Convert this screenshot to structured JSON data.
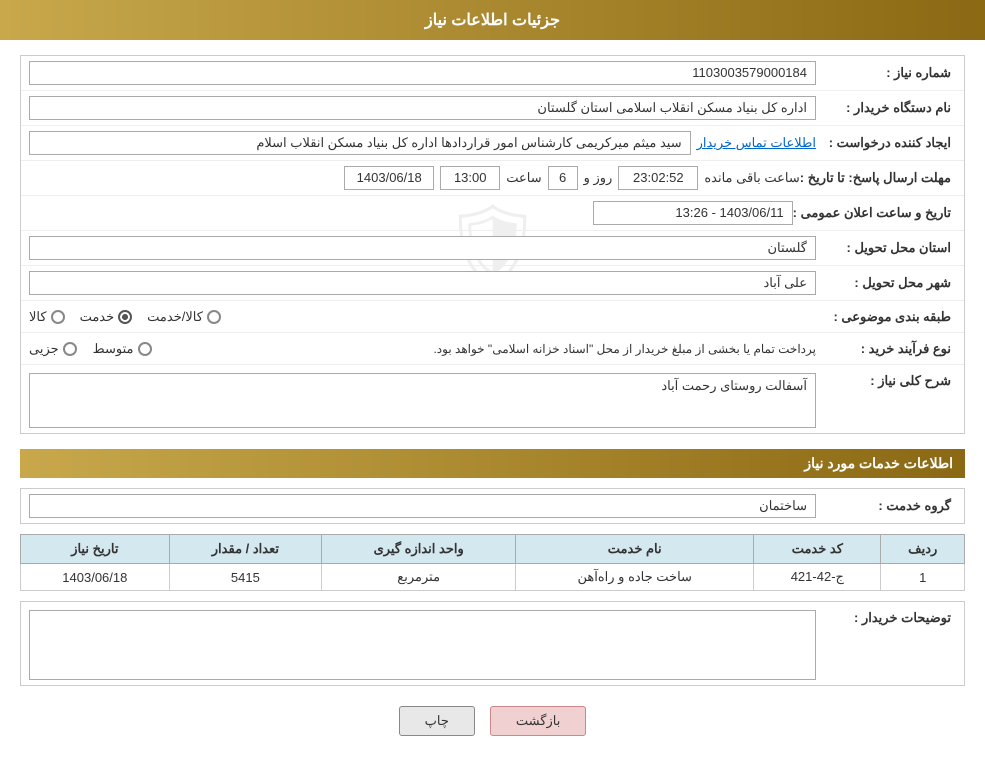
{
  "header": {
    "title": "جزئیات اطلاعات نیاز"
  },
  "fields": {
    "need_number_label": "شماره نیاز :",
    "need_number_value": "1103003579000184",
    "buyer_org_label": "نام دستگاه خریدار :",
    "buyer_org_value": "اداره کل بنیاد مسکن انقلاب اسلامی استان گلستان",
    "creator_label": "ایجاد کننده درخواست :",
    "creator_value": "سید میثم میرکریمی کارشناس امور قراردادها اداره کل بنیاد مسکن انقلاب اسلام",
    "creator_link": "اطلاعات تماس خریدار",
    "deadline_label": "مهلت ارسال پاسخ: تا تاریخ :",
    "deadline_date": "1403/06/18",
    "deadline_time": "13:00",
    "deadline_days": "6",
    "deadline_remaining": "23:02:52",
    "deadline_remaining_suffix": "ساعت باقی مانده",
    "deadline_days_suffix": "روز و",
    "announce_label": "تاریخ و ساعت اعلان عمومی :",
    "announce_value": "1403/06/11 - 13:26",
    "province_label": "استان محل تحویل :",
    "province_value": "گلستان",
    "city_label": "شهر محل تحویل :",
    "city_value": "علی آباد",
    "category_label": "طبقه بندی موضوعی :",
    "category_options": [
      "کالا",
      "خدمت",
      "کالا/خدمت"
    ],
    "category_selected": "خدمت",
    "purchase_type_label": "نوع فرآیند خرید :",
    "purchase_type_options": [
      "جزیی",
      "متوسط"
    ],
    "purchase_type_note": "پرداخت تمام یا بخشی از مبلغ خریدار از محل \"اسناد خزانه اسلامی\" خواهد بود.",
    "need_desc_label": "شرح کلی نیاز :",
    "need_desc_value": "آسفالت روستای رحمت آباد",
    "services_title": "اطلاعات خدمات مورد نیاز",
    "service_group_label": "گروه خدمت :",
    "service_group_value": "ساختمان",
    "table_headers": [
      "ردیف",
      "کد خدمت",
      "نام خدمت",
      "واحد اندازه گیری",
      "تعداد / مقدار",
      "تاریخ نیاز"
    ],
    "table_rows": [
      {
        "row": "1",
        "code": "ج-42-421",
        "name": "ساخت جاده و راه‌آهن",
        "unit": "مترمربع",
        "quantity": "5415",
        "date": "1403/06/18"
      }
    ],
    "buyer_notes_label": "توضیحات خریدار :",
    "buyer_notes_value": ""
  },
  "buttons": {
    "print_label": "چاپ",
    "back_label": "بازگشت"
  }
}
